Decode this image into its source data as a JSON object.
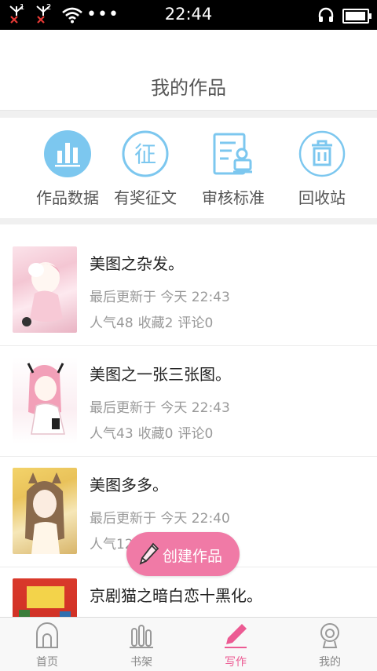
{
  "status_bar": {
    "time": "22:44",
    "sim1_label": "1",
    "sim2_label": "2",
    "dots": "•••"
  },
  "header": {
    "title": "我的作品"
  },
  "actions": [
    {
      "label": "作品数据",
      "icon": "bar-chart-icon"
    },
    {
      "label": "有奖征文",
      "icon": "contest-icon",
      "glyph": "征"
    },
    {
      "label": "审核标准",
      "icon": "review-standard-icon"
    },
    {
      "label": "回收站",
      "icon": "trash-icon"
    }
  ],
  "works": [
    {
      "title": "美图之杂发。",
      "updated": "最后更新于 今天 22:43",
      "popularity": "人气48",
      "favorites": "收藏2",
      "comments": "评论0"
    },
    {
      "title": "美图之一张三张图。",
      "updated": "最后更新于 今天 22:43",
      "popularity": "人气43",
      "favorites": "收藏0",
      "comments": "评论0"
    },
    {
      "title": "美图多多。",
      "updated": "最后更新于 今天 22:40",
      "popularity": "人气12",
      "favorites": "",
      "comments": ""
    },
    {
      "title": "京剧猫之暗白恋十黑化。",
      "updated": "",
      "popularity": "",
      "favorites": "",
      "comments": ""
    }
  ],
  "fab": {
    "label": "创建作品",
    "icon": "pen-icon"
  },
  "tabs": [
    {
      "label": "首页",
      "icon": "home-icon",
      "active": false
    },
    {
      "label": "书架",
      "icon": "bookshelf-icon",
      "active": false
    },
    {
      "label": "写作",
      "icon": "write-icon",
      "active": true
    },
    {
      "label": "我的",
      "icon": "profile-icon",
      "active": false
    }
  ],
  "colors": {
    "accent": "#ec5b93",
    "fab": "#f07aa6",
    "icon_blue": "#7cc7ef",
    "status_bar": "#000000"
  }
}
